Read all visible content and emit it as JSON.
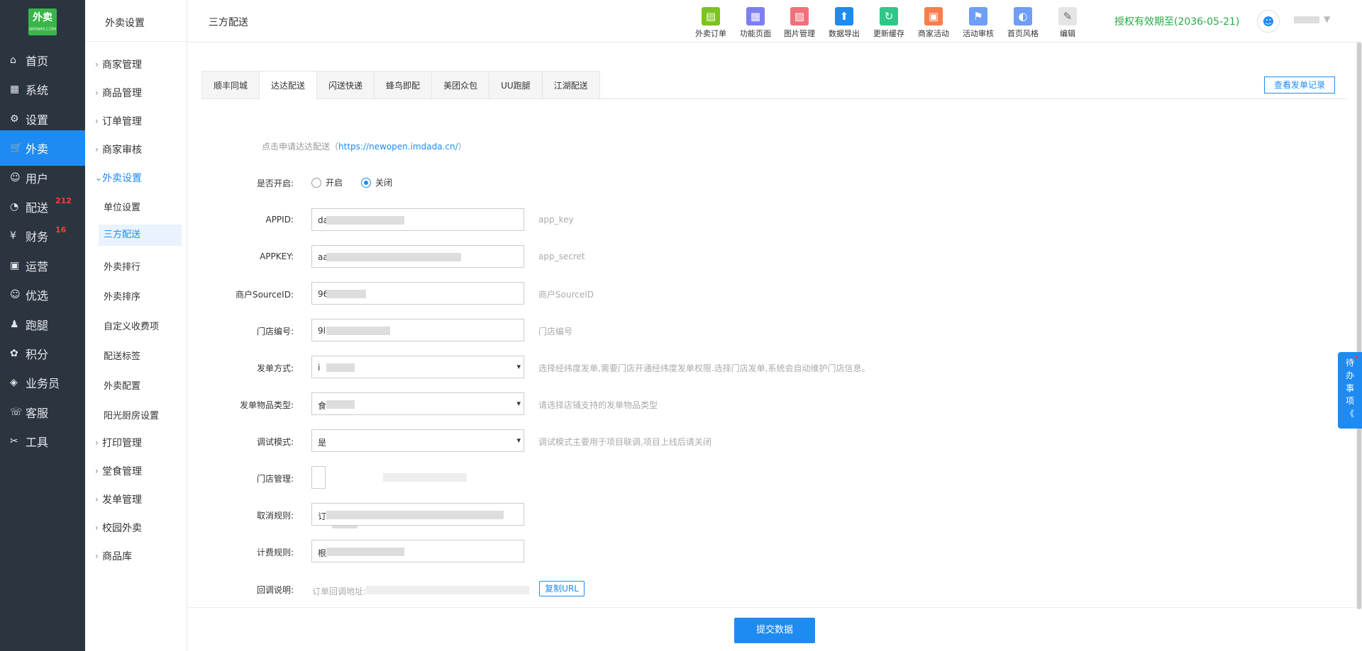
{
  "app": {
    "logo_text": "外卖",
    "logo_sub": "WMWM.COM"
  },
  "nav": [
    {
      "label": "首页",
      "icon": "⌂",
      "badge": ""
    },
    {
      "label": "系统",
      "icon": "▦",
      "badge": ""
    },
    {
      "label": "设置",
      "icon": "⚙",
      "badge": ""
    },
    {
      "label": "外卖",
      "icon": "🛒",
      "badge": ""
    },
    {
      "label": "用户",
      "icon": "☺",
      "badge": ""
    },
    {
      "label": "配送",
      "icon": "◔",
      "badge": "212"
    },
    {
      "label": "财务",
      "icon": "¥",
      "badge": "16"
    },
    {
      "label": "运营",
      "icon": "▣",
      "badge": ""
    },
    {
      "label": "优选",
      "icon": "☺",
      "badge": ""
    },
    {
      "label": "跑腿",
      "icon": "♟",
      "badge": ""
    },
    {
      "label": "积分",
      "icon": "✿",
      "badge": ""
    },
    {
      "label": "业务员",
      "icon": "◈",
      "badge": ""
    },
    {
      "label": "客服",
      "icon": "☏",
      "badge": ""
    },
    {
      "label": "工具",
      "icon": "✂",
      "badge": ""
    }
  ],
  "sub_nav": {
    "header": "外卖设置",
    "groups_top": [
      "商家管理",
      "商品管理",
      "订单管理",
      "商家审核"
    ],
    "open_group": "外卖设置",
    "items": [
      "单位设置",
      "三方配送",
      "外卖排行",
      "外卖排序",
      "自定义收费项",
      "配送标签",
      "外卖配置",
      "阳光厨房设置"
    ],
    "groups_bottom": [
      "打印管理",
      "堂食管理",
      "发单管理",
      "校园外卖",
      "商品库"
    ]
  },
  "topbar": {
    "title": "三方配送",
    "tools": [
      {
        "label": "外卖订单",
        "icon": "▤",
        "color": "#7cc31e"
      },
      {
        "label": "功能页面",
        "icon": "▦",
        "color": "#7d7ff0"
      },
      {
        "label": "图片管理",
        "icon": "▨",
        "color": "#f0717a"
      },
      {
        "label": "数据导出",
        "icon": "⬆",
        "color": "#1e8bf3"
      },
      {
        "label": "更新缓存",
        "icon": "↻",
        "color": "#2fc787"
      },
      {
        "label": "商家活动",
        "icon": "▣",
        "color": "#f97d4c"
      },
      {
        "label": "活动审核",
        "icon": "⚑",
        "color": "#6e9ef5"
      },
      {
        "label": "首页风格",
        "icon": "◐",
        "color": "#6e9ef5"
      },
      {
        "label": "编辑",
        "icon": "✎",
        "color": "#e5e5e5"
      }
    ],
    "license": "授权有效期至(2036-05-21)"
  },
  "tabs": [
    "顺丰同城",
    "达达配送",
    "闪送快递",
    "蜂鸟即配",
    "美团众包",
    "UU跑腿",
    "江湖配送"
  ],
  "active_tab": "达达配送",
  "record_button": "查看发单记录",
  "apply_text": "点击申请达达配送（",
  "apply_link": "https://newopen.imdada.cn/",
  "apply_close": "）",
  "form": {
    "enable_label": "是否开启:",
    "enable_on": "开启",
    "enable_off": "关闭",
    "appid_label": "APPID:",
    "appid_prefix": "da",
    "appid_hint": "app_key",
    "appkey_label": "APPKEY:",
    "appkey_prefix": "aa",
    "appkey_hint": "app_secret",
    "source_label": "商户SourceID:",
    "source_prefix": "96",
    "source_hint": "商户SourceID",
    "store_no_label": "门店编号:",
    "store_no_prefix": "9l",
    "store_no_hint": "门店编号",
    "mode_label": "发单方式:",
    "mode_prefix": "i",
    "mode_hint": "选择经纬度发单,需要门店开通经纬度发单权限.选择门店发单,系统会自动维护门店信息。",
    "goods_label": "发单物品类型:",
    "goods_prefix": "食",
    "goods_hint": "请选择店铺支持的发单物品类型",
    "debug_label": "调试模式:",
    "debug_prefix": "是",
    "debug_hint": "调试模式主要用于项目联调,项目上线后请关闭",
    "store_mgr_label": "门店管理:",
    "cancel_label": "取消规则:",
    "cancel_prefix": "订",
    "fee_label": "计费规则:",
    "fee_prefix": "根",
    "callback_label": "回调说明:",
    "callback_text": "订单回调地址:",
    "copy_button": "复制URL"
  },
  "submit_button": "提交数据",
  "todo": [
    "待",
    "办",
    "事",
    "项",
    "《"
  ]
}
